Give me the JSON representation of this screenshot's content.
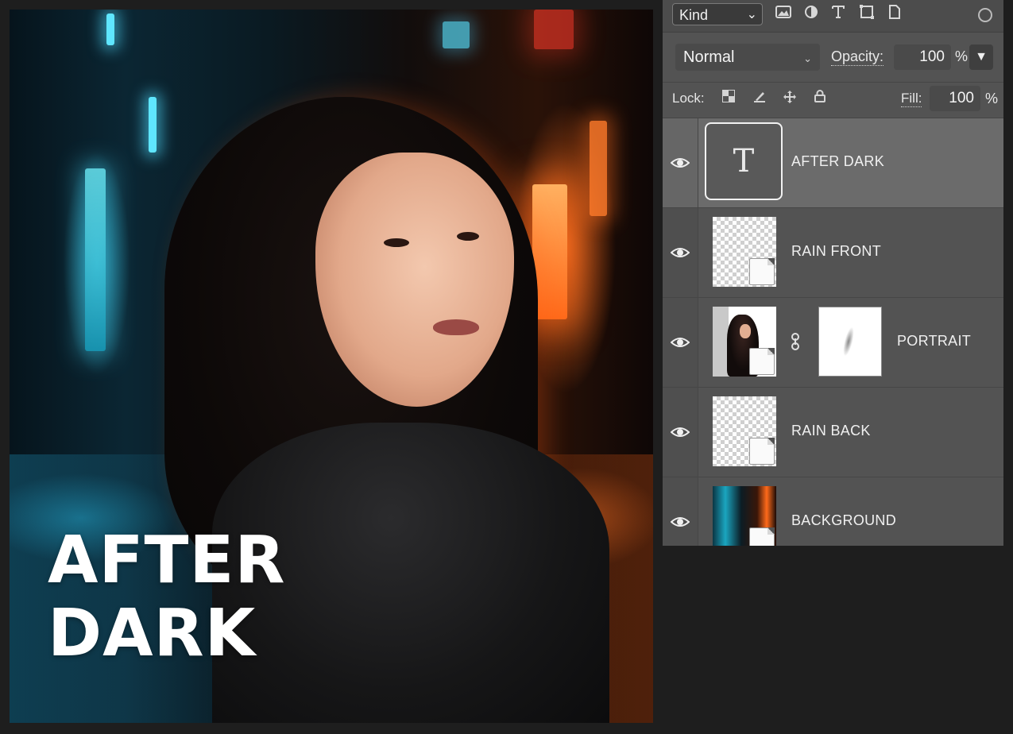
{
  "artwork": {
    "title_line1": "AFTER",
    "title_line2": "DARK"
  },
  "layers_panel": {
    "filter": {
      "kind_label": "Kind",
      "icons": [
        "image-filter-icon",
        "adjustment-filter-icon",
        "type-filter-icon",
        "shape-filter-icon",
        "smart-object-filter-icon"
      ],
      "toggle": "filter-toggle-icon"
    },
    "blend": {
      "mode": "Normal",
      "opacity_label": "Opacity:",
      "opacity_value": "100",
      "percent": "%"
    },
    "lock": {
      "label": "Lock:",
      "icons": [
        "lock-transparent-pixels-icon",
        "lock-image-pixels-icon",
        "lock-position-icon",
        "lock-all-icon"
      ],
      "fill_label": "Fill:",
      "fill_value": "100",
      "percent": "%"
    },
    "layers": [
      {
        "name": "AFTER DARK",
        "type": "text",
        "visible": true,
        "selected": true,
        "thumb_glyph": "T"
      },
      {
        "name": "RAIN FRONT",
        "type": "smart-object",
        "visible": true,
        "selected": false
      },
      {
        "name": "PORTRAIT",
        "type": "smart-object-with-mask",
        "visible": true,
        "selected": false
      },
      {
        "name": "RAIN BACK",
        "type": "smart-object",
        "visible": true,
        "selected": false
      },
      {
        "name": "BACKGROUND",
        "type": "smart-object",
        "visible": true,
        "selected": false
      }
    ]
  },
  "colors": {
    "app_background": "#1e1e1e",
    "panel_background": "#535353",
    "selected_layer": "#6b6b6b",
    "neon_cyan": "#5fe6ff",
    "neon_orange": "#ff6a1a"
  }
}
